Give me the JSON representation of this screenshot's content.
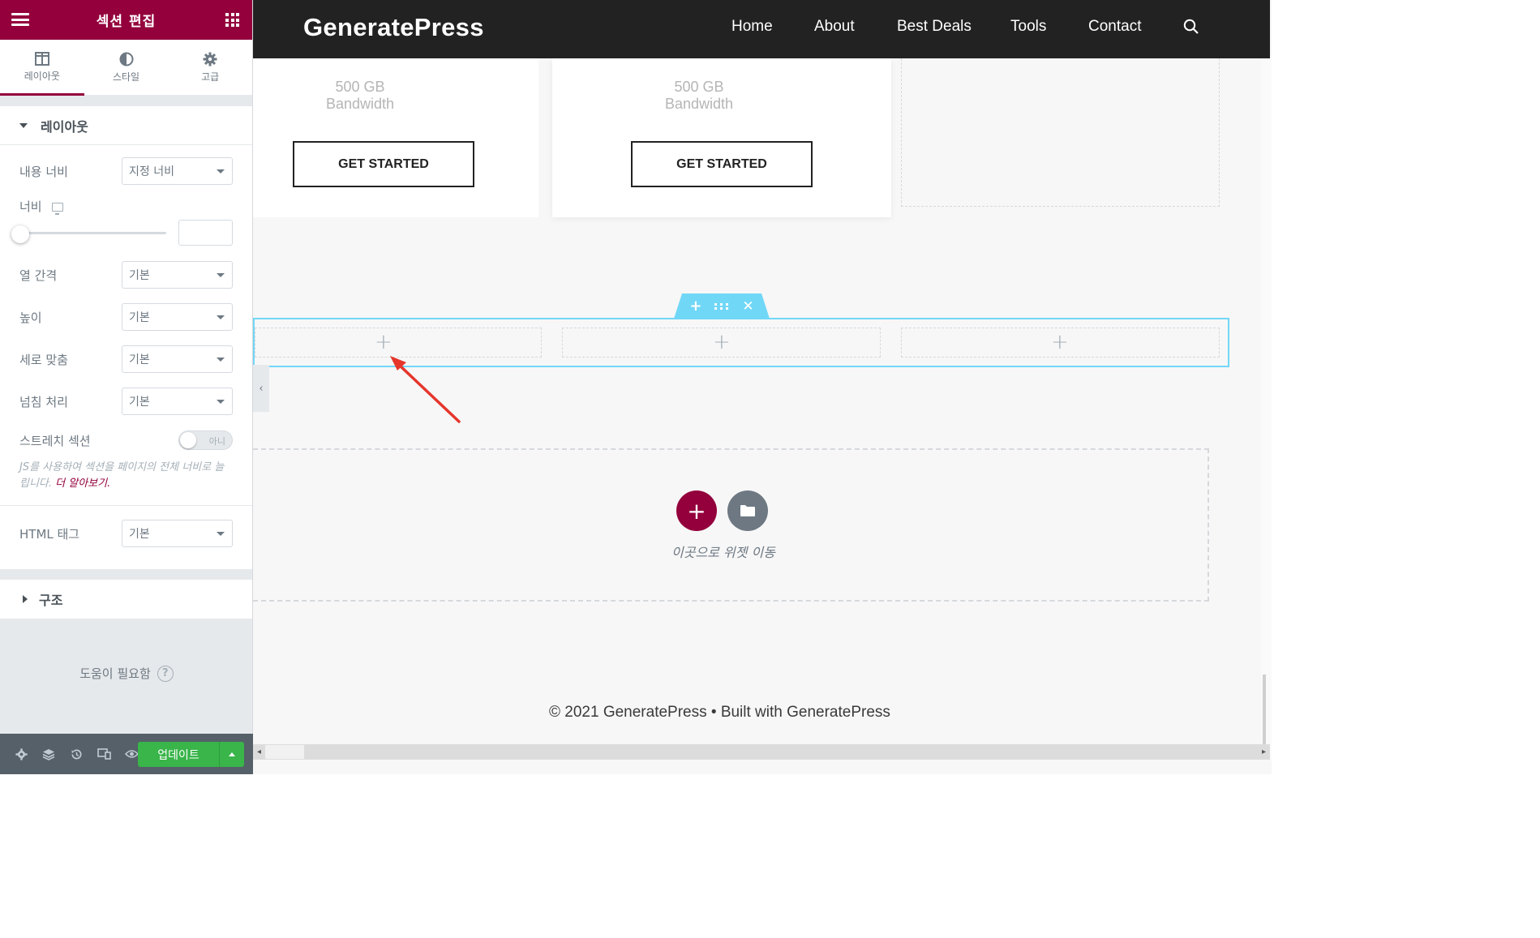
{
  "panel": {
    "title": "섹션 편집",
    "tabs": [
      {
        "label": "레이아웃",
        "icon": "columns-icon"
      },
      {
        "label": "스타일",
        "icon": "half-circle-icon"
      },
      {
        "label": "고급",
        "icon": "gear-icon"
      }
    ],
    "layout_section": {
      "title": "레이아웃",
      "content_width": {
        "label": "내용 너비",
        "value": "지정 너비"
      },
      "width": {
        "label": "너비",
        "value": ""
      },
      "column_gap": {
        "label": "열 간격",
        "value": "기본"
      },
      "height": {
        "label": "높이",
        "value": "기본"
      },
      "vertical_align": {
        "label": "세로 맞춤",
        "value": "기본"
      },
      "overflow": {
        "label": "넘침 처리",
        "value": "기본"
      },
      "stretch": {
        "label": "스트레치 섹션",
        "value": "아니",
        "enabled": false
      },
      "stretch_desc": "JS를 사용하여 섹션을 페이지의 전체 너비로 늘립니다.",
      "learn_more": "더 알아보기.",
      "html_tag": {
        "label": "HTML 태그",
        "value": "기본"
      }
    },
    "structure_section": {
      "title": "구조"
    },
    "help": {
      "label": "도움이 필요함",
      "icon": "question-circle-icon"
    },
    "footer": {
      "icons": [
        "gear-icon",
        "layers-icon",
        "history-icon",
        "responsive-icon",
        "eye-icon"
      ],
      "update_label": "업데이트"
    }
  },
  "site": {
    "brand": "GeneratePress",
    "nav": [
      "Home",
      "About",
      "Best Deals",
      "Tools",
      "Contact"
    ],
    "cards": [
      {
        "bandwidth_value": "500 GB",
        "bandwidth_label": "Bandwidth",
        "button": "GET STARTED"
      },
      {
        "bandwidth_value": "500 GB",
        "bandwidth_label": "Bandwidth",
        "button": "GET STARTED"
      }
    ],
    "drop_zone_text": "이곳으로 위젯 이동",
    "footer": "© 2021 GeneratePress • Built with GeneratePress"
  },
  "colors": {
    "brand": "#93003c",
    "selection": "#71d7f7",
    "update": "#39b54a",
    "nav_bg": "#222222"
  }
}
